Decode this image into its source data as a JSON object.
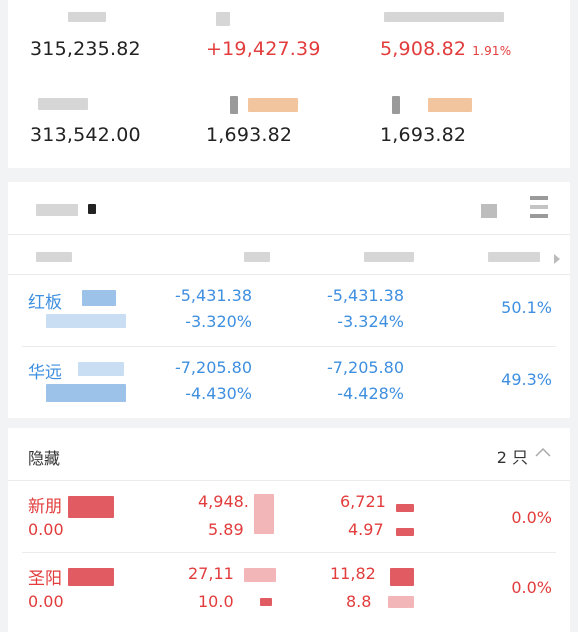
{
  "summary": {
    "total_assets": "315,235.82",
    "day_change": "+19,427.39",
    "total_profit": "5,908.82",
    "total_profit_pct": "1.91%",
    "market_value": "313,542.00",
    "profit_a": "1,693.82",
    "profit_b": "1,693.82"
  },
  "holdings": [
    {
      "name": "红板",
      "profit_amount": "-5,431.38",
      "profit_pct": "-3.320%",
      "day_amount": "-5,431.38",
      "day_pct": "-3.324%",
      "position": "50.1%"
    },
    {
      "name": "华远",
      "profit_amount": "-7,205.80",
      "profit_pct": "-4.430%",
      "day_amount": "-7,205.80",
      "day_pct": "-4.428%",
      "position": "49.3%"
    }
  ],
  "hidden_section": {
    "title": "隐藏",
    "count": "2 只",
    "items": [
      {
        "name": "新朋",
        "sub": "0.00",
        "value_a": "4,948.",
        "value_a2": "5.89",
        "value_b": "6,721",
        "value_b2": "4.97",
        "position": "0.0%"
      },
      {
        "name": "圣阳",
        "sub": "0.00",
        "value_a": "27,11",
        "value_a2": "10.0",
        "value_b": "11,82",
        "value_b2": "8.8",
        "position": "0.0%"
      }
    ]
  },
  "colors": {
    "up": "#e23c3c",
    "down": "#3e8fe0",
    "background": "#f2f3f5"
  },
  "icons": [
    "filter-icon",
    "list-icon",
    "chevron-up-icon",
    "triangle-right-icon"
  ]
}
